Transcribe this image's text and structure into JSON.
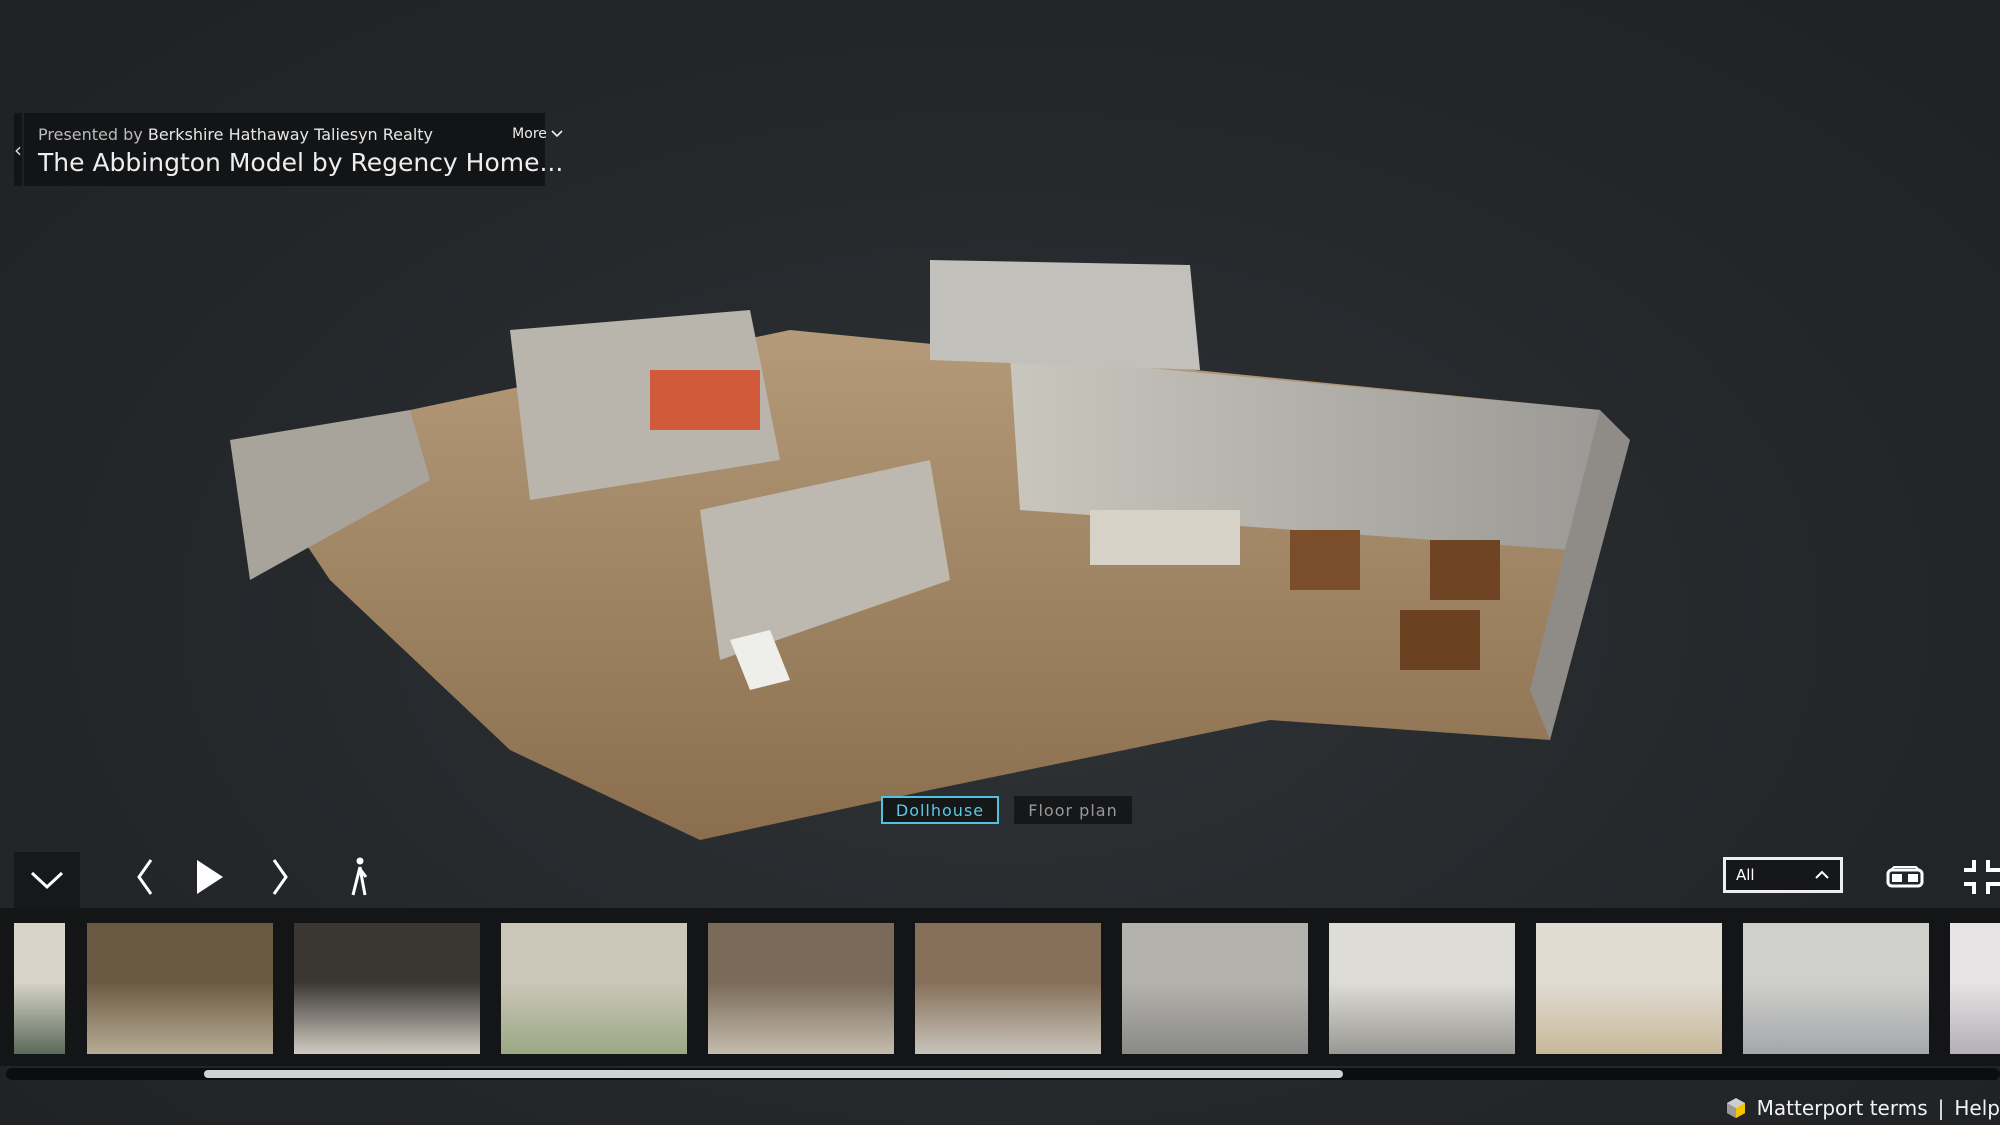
{
  "header": {
    "presented_prefix": "Presented by",
    "presenter": "Berkshire Hathaway Taliesyn Realty",
    "title": "The Abbington Model by Regency Home...",
    "more_label": "More"
  },
  "view_modes": [
    {
      "label": "Dollhouse",
      "active": true
    },
    {
      "label": "Floor plan",
      "active": false
    }
  ],
  "controls": {
    "floor_select_value": "All"
  },
  "thumbnails": [
    {
      "name": "window",
      "colors": [
        "#5a6a5a",
        "#d8d4c8"
      ]
    },
    {
      "name": "dining-room",
      "colors": [
        "#b8ab94",
        "#6a5a44"
      ]
    },
    {
      "name": "kitchen",
      "colors": [
        "#d0ccc2",
        "#3a3632"
      ]
    },
    {
      "name": "dining-windows",
      "colors": [
        "#9aa884",
        "#ccc6b8"
      ]
    },
    {
      "name": "living-room-fireplace",
      "colors": [
        "#c4bcae",
        "#7a6a58"
      ]
    },
    {
      "name": "living-room",
      "colors": [
        "#c8c4ba",
        "#86705a"
      ]
    },
    {
      "name": "bedroom-dark",
      "colors": [
        "#8a8a88",
        "#b4b2ac"
      ]
    },
    {
      "name": "master-bedroom",
      "colors": [
        "#9a9894",
        "#dedcd6"
      ]
    },
    {
      "name": "bathroom-vanity",
      "colors": [
        "#c8b89a",
        "#e0dcd2"
      ]
    },
    {
      "name": "bathroom-shower",
      "colors": [
        "#a4a8aa",
        "#cfcfcc"
      ]
    },
    {
      "name": "nursery",
      "colors": [
        "#b4aeb6",
        "#e6e4e4"
      ]
    }
  ],
  "footer": {
    "terms": "Matterport terms",
    "separator": "|",
    "help": "Help"
  },
  "colors": {
    "accent": "#4fc3e0",
    "background": "#2a2d30"
  }
}
